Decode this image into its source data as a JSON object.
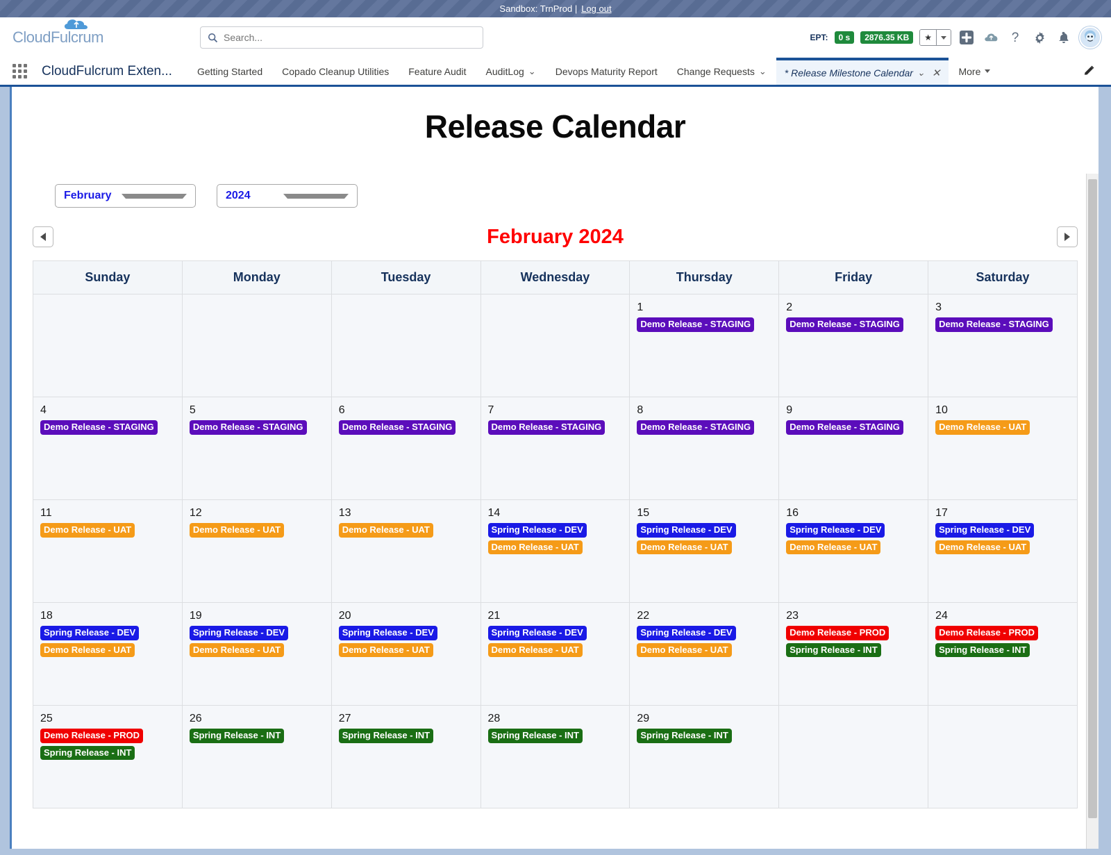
{
  "sandbox": {
    "text": "Sandbox: TrnProd |",
    "logout_label": "Log out"
  },
  "header": {
    "brand": "CloudFulcrum",
    "app_name": "CloudFulcrum Exten...",
    "search_placeholder": "Search...",
    "search_value": "",
    "ept_label": "EPT:",
    "ept_time": "0 s",
    "ept_size": "2876.35 KB",
    "more_label": "More"
  },
  "nav": {
    "items": [
      {
        "label": "Getting Started",
        "has_caret": false,
        "active": false
      },
      {
        "label": "Copado Cleanup Utilities",
        "has_caret": false,
        "active": false
      },
      {
        "label": "Feature Audit",
        "has_caret": false,
        "active": false
      },
      {
        "label": "AuditLog",
        "has_caret": true,
        "active": false
      },
      {
        "label": "Devops Maturity Report",
        "has_caret": false,
        "active": false
      },
      {
        "label": "Change Requests",
        "has_caret": true,
        "active": false
      }
    ],
    "active_tab": "* Release Milestone Calendar"
  },
  "main": {
    "title": "Release Calendar",
    "month_select": "February",
    "year_select": "2024",
    "month_title": "February 2024",
    "weekdays": [
      "Sunday",
      "Monday",
      "Tuesday",
      "Wednesday",
      "Thursday",
      "Friday",
      "Saturday"
    ]
  },
  "colors": {
    "staging": "#5b0dbb",
    "uat": "#f59b18",
    "dev": "#1a1ae6",
    "prod": "#f00000",
    "int": "#1a6e14",
    "month_title": "#ff0000",
    "weekday": "#16325c",
    "select_text": "#1a1ae6"
  },
  "calendar": {
    "weeks": [
      [
        {
          "day": "",
          "events": []
        },
        {
          "day": "",
          "events": []
        },
        {
          "day": "",
          "events": []
        },
        {
          "day": "",
          "events": []
        },
        {
          "day": "1",
          "events": [
            {
              "label": "Demo Release - STAGING",
              "env": "staging"
            }
          ]
        },
        {
          "day": "2",
          "events": [
            {
              "label": "Demo Release - STAGING",
              "env": "staging"
            }
          ]
        },
        {
          "day": "3",
          "events": [
            {
              "label": "Demo Release - STAGING",
              "env": "staging"
            }
          ]
        }
      ],
      [
        {
          "day": "4",
          "events": [
            {
              "label": "Demo Release - STAGING",
              "env": "staging"
            }
          ]
        },
        {
          "day": "5",
          "events": [
            {
              "label": "Demo Release - STAGING",
              "env": "staging"
            }
          ]
        },
        {
          "day": "6",
          "events": [
            {
              "label": "Demo Release - STAGING",
              "env": "staging"
            }
          ]
        },
        {
          "day": "7",
          "events": [
            {
              "label": "Demo Release - STAGING",
              "env": "staging"
            }
          ]
        },
        {
          "day": "8",
          "events": [
            {
              "label": "Demo Release - STAGING",
              "env": "staging"
            }
          ]
        },
        {
          "day": "9",
          "events": [
            {
              "label": "Demo Release - STAGING",
              "env": "staging"
            }
          ]
        },
        {
          "day": "10",
          "events": [
            {
              "label": "Demo Release - UAT",
              "env": "uat"
            }
          ]
        }
      ],
      [
        {
          "day": "11",
          "events": [
            {
              "label": "Demo Release - UAT",
              "env": "uat"
            }
          ]
        },
        {
          "day": "12",
          "events": [
            {
              "label": "Demo Release - UAT",
              "env": "uat"
            }
          ]
        },
        {
          "day": "13",
          "events": [
            {
              "label": "Demo Release - UAT",
              "env": "uat"
            }
          ]
        },
        {
          "day": "14",
          "events": [
            {
              "label": "Spring Release - DEV",
              "env": "dev"
            },
            {
              "label": "Demo Release - UAT",
              "env": "uat"
            }
          ]
        },
        {
          "day": "15",
          "events": [
            {
              "label": "Spring Release - DEV",
              "env": "dev"
            },
            {
              "label": "Demo Release - UAT",
              "env": "uat"
            }
          ]
        },
        {
          "day": "16",
          "events": [
            {
              "label": "Spring Release - DEV",
              "env": "dev"
            },
            {
              "label": "Demo Release - UAT",
              "env": "uat"
            }
          ]
        },
        {
          "day": "17",
          "events": [
            {
              "label": "Spring Release - DEV",
              "env": "dev"
            },
            {
              "label": "Demo Release - UAT",
              "env": "uat"
            }
          ]
        }
      ],
      [
        {
          "day": "18",
          "events": [
            {
              "label": "Spring Release - DEV",
              "env": "dev"
            },
            {
              "label": "Demo Release - UAT",
              "env": "uat"
            }
          ]
        },
        {
          "day": "19",
          "events": [
            {
              "label": "Spring Release - DEV",
              "env": "dev"
            },
            {
              "label": "Demo Release - UAT",
              "env": "uat"
            }
          ]
        },
        {
          "day": "20",
          "events": [
            {
              "label": "Spring Release - DEV",
              "env": "dev"
            },
            {
              "label": "Demo Release - UAT",
              "env": "uat"
            }
          ]
        },
        {
          "day": "21",
          "events": [
            {
              "label": "Spring Release - DEV",
              "env": "dev"
            },
            {
              "label": "Demo Release - UAT",
              "env": "uat"
            }
          ]
        },
        {
          "day": "22",
          "events": [
            {
              "label": "Spring Release - DEV",
              "env": "dev"
            },
            {
              "label": "Demo Release - UAT",
              "env": "uat"
            }
          ]
        },
        {
          "day": "23",
          "events": [
            {
              "label": "Demo Release - PROD",
              "env": "prod"
            },
            {
              "label": "Spring Release - INT",
              "env": "int"
            }
          ]
        },
        {
          "day": "24",
          "events": [
            {
              "label": "Demo Release - PROD",
              "env": "prod"
            },
            {
              "label": "Spring Release - INT",
              "env": "int"
            }
          ]
        }
      ],
      [
        {
          "day": "25",
          "events": [
            {
              "label": "Demo Release - PROD",
              "env": "prod"
            },
            {
              "label": "Spring Release - INT",
              "env": "int"
            }
          ]
        },
        {
          "day": "26",
          "events": [
            {
              "label": "Spring Release - INT",
              "env": "int"
            }
          ]
        },
        {
          "day": "27",
          "events": [
            {
              "label": "Spring Release - INT",
              "env": "int"
            }
          ]
        },
        {
          "day": "28",
          "events": [
            {
              "label": "Spring Release - INT",
              "env": "int"
            }
          ]
        },
        {
          "day": "29",
          "events": [
            {
              "label": "Spring Release - INT",
              "env": "int"
            }
          ]
        },
        {
          "day": "",
          "events": []
        },
        {
          "day": "",
          "events": []
        }
      ]
    ]
  }
}
